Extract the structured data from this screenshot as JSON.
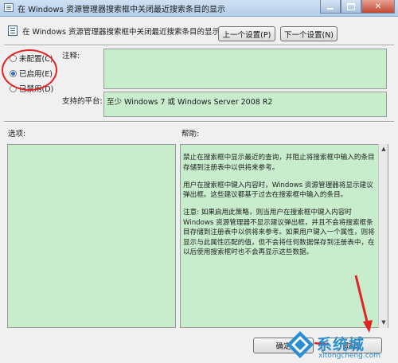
{
  "window": {
    "title": "在 Windows 资源管理器搜索框中关闭最近搜索条目的显示",
    "controls": [
      "minimize-icon",
      "maximize-icon",
      "close-icon"
    ]
  },
  "header": {
    "title": "在 Windows 资源管理器搜索框中关闭最近搜索条目的显示",
    "prev_button": "上一个设置(P)",
    "next_button": "下一个设置(N)"
  },
  "state": {
    "options": [
      {
        "label": "未配置(C)",
        "selected": false
      },
      {
        "label": "已启用(E)",
        "selected": true
      },
      {
        "label": "已禁用(D)",
        "selected": false
      }
    ]
  },
  "comment": {
    "label": "注释:",
    "value": ""
  },
  "platform": {
    "label": "支持的平台:",
    "value": "至少 Windows 7 或 Windows Server 2008 R2"
  },
  "options_section": {
    "label": "选项:"
  },
  "help_section": {
    "label": "帮助:",
    "paragraphs": [
      "禁止在搜索框中显示最近的查询，并阻止将搜索框中输入的条目存储到注册表中以供将来参考。",
      "用户在搜索框中键入内容时，Windows 资源管理器将显示建议弹出框。这些建议都基于过去在搜索框中输入的条目。",
      "注意: 如果启用此策略，则当用户在搜索框中键入内容时 Windows 资源管理器不显示建议弹出框，并且不会将搜索框条目存储到注册表中以供将来参考。如果用户键入一个属性，则将显示与此属性匹配的值，但不会将任何数据保存到注册表中，在以后使用搜索框时也不会再显示这些数据。"
    ]
  },
  "footer": {
    "ok_button": "确定",
    "cancel_button": "取消"
  },
  "annotation": {
    "color": "#e02424"
  },
  "watermark": {
    "name": "系统城",
    "url": "xitongcheng.com"
  }
}
